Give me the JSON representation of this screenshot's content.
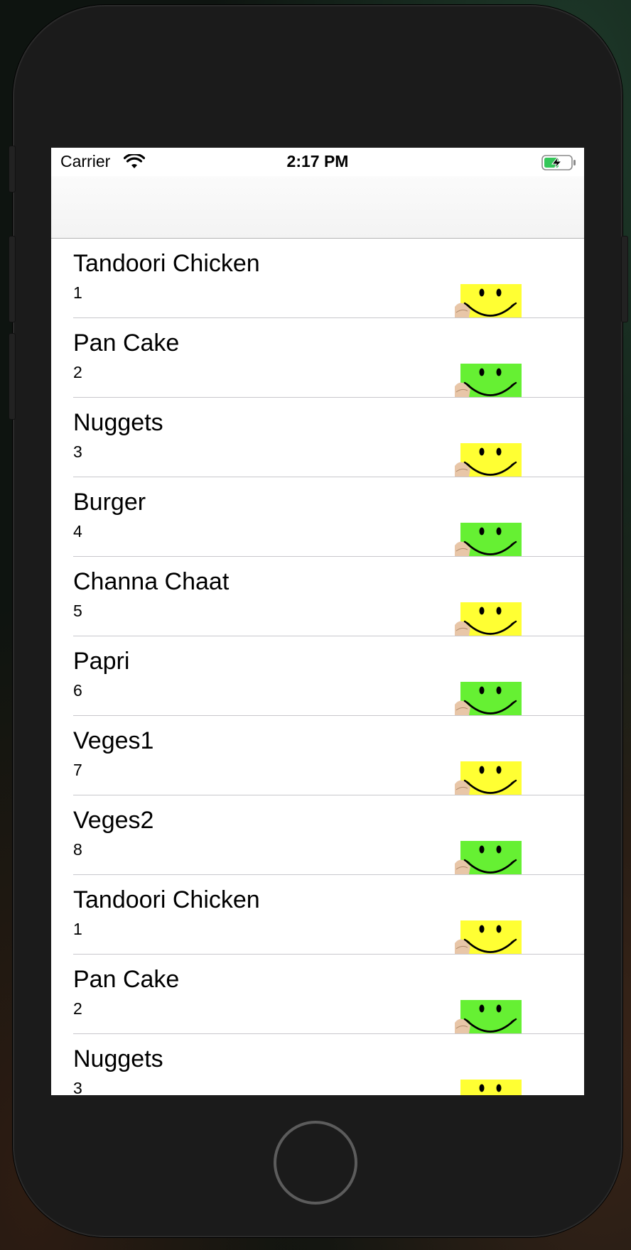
{
  "status_bar": {
    "carrier": "Carrier",
    "time": "2:17 PM",
    "icons": [
      "wifi-icon",
      "battery-charging-icon"
    ]
  },
  "colors": {
    "thumb_yellow": "#ffff33",
    "thumb_green": "#66f033",
    "separator": "#c8c7cc"
  },
  "table": {
    "rows": [
      {
        "title": "Tandoori Chicken",
        "subtitle": "1",
        "thumb": "smiley-yellow"
      },
      {
        "title": "Pan Cake",
        "subtitle": "2",
        "thumb": "smiley-green"
      },
      {
        "title": "Nuggets",
        "subtitle": "3",
        "thumb": "smiley-yellow"
      },
      {
        "title": "Burger",
        "subtitle": "4",
        "thumb": "smiley-green"
      },
      {
        "title": "Channa Chaat",
        "subtitle": "5",
        "thumb": "smiley-yellow"
      },
      {
        "title": "Papri",
        "subtitle": "6",
        "thumb": "smiley-green"
      },
      {
        "title": "Veges1",
        "subtitle": "7",
        "thumb": "smiley-yellow"
      },
      {
        "title": "Veges2",
        "subtitle": "8",
        "thumb": "smiley-green"
      },
      {
        "title": "Tandoori Chicken",
        "subtitle": "1",
        "thumb": "smiley-yellow"
      },
      {
        "title": "Pan Cake",
        "subtitle": "2",
        "thumb": "smiley-green"
      },
      {
        "title": "Nuggets",
        "subtitle": "3",
        "thumb": "smiley-yellow"
      }
    ]
  }
}
